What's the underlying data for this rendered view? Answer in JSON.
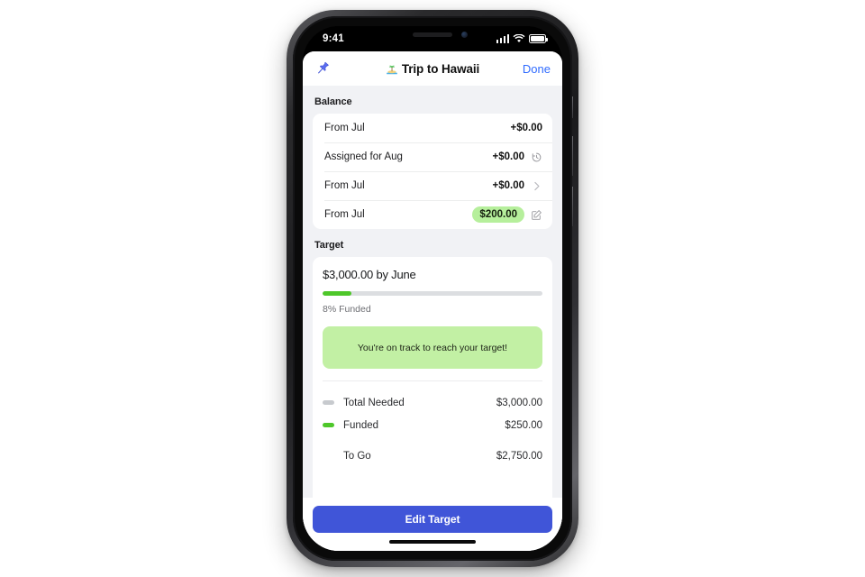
{
  "status_bar": {
    "time": "9:41",
    "icons": [
      "cellular-signal-icon",
      "wifi-icon",
      "battery-icon"
    ]
  },
  "nav": {
    "pin_icon": "pushpin-icon",
    "title": "Trip to Hawaii",
    "title_emoji": "desert-island-emoji",
    "done_label": "Done"
  },
  "balance": {
    "section_title": "Balance",
    "rows": [
      {
        "label": "From Jul",
        "amount": "+$0.00",
        "icon": "none",
        "highlighted": false
      },
      {
        "label": "Assigned for Aug",
        "amount": "+$0.00",
        "icon": "history-clock-icon",
        "highlighted": false
      },
      {
        "label": "From Jul",
        "amount": "+$0.00",
        "icon": "chevron-right-icon",
        "highlighted": false
      },
      {
        "label": "From Jul",
        "amount": "$200.00",
        "icon": "edit-pencil-icon",
        "highlighted": true
      }
    ]
  },
  "target": {
    "section_title": "Target",
    "headline": "$3,000.00 by June",
    "progress_percent": 8,
    "progress_fill_ratio": 0.13,
    "funded_label": "8% Funded",
    "tip_message": "You're on track to reach your target!",
    "legend": [
      {
        "marker": "gray",
        "label": "Total Needed",
        "value": "$3,000.00"
      },
      {
        "marker": "green",
        "label": "Funded",
        "value": "$250.00"
      },
      {
        "marker": "none",
        "label": "To Go",
        "value": "$2,750.00"
      }
    ],
    "cta_label": "Edit Target"
  },
  "colors": {
    "accent_blue": "#4055d8",
    "link_blue": "#2f6bff",
    "progress_green": "#4ec72a",
    "pill_green": "#b6ef9c",
    "tip_green": "#c2f0a4",
    "page_bg": "#f1f2f5"
  }
}
